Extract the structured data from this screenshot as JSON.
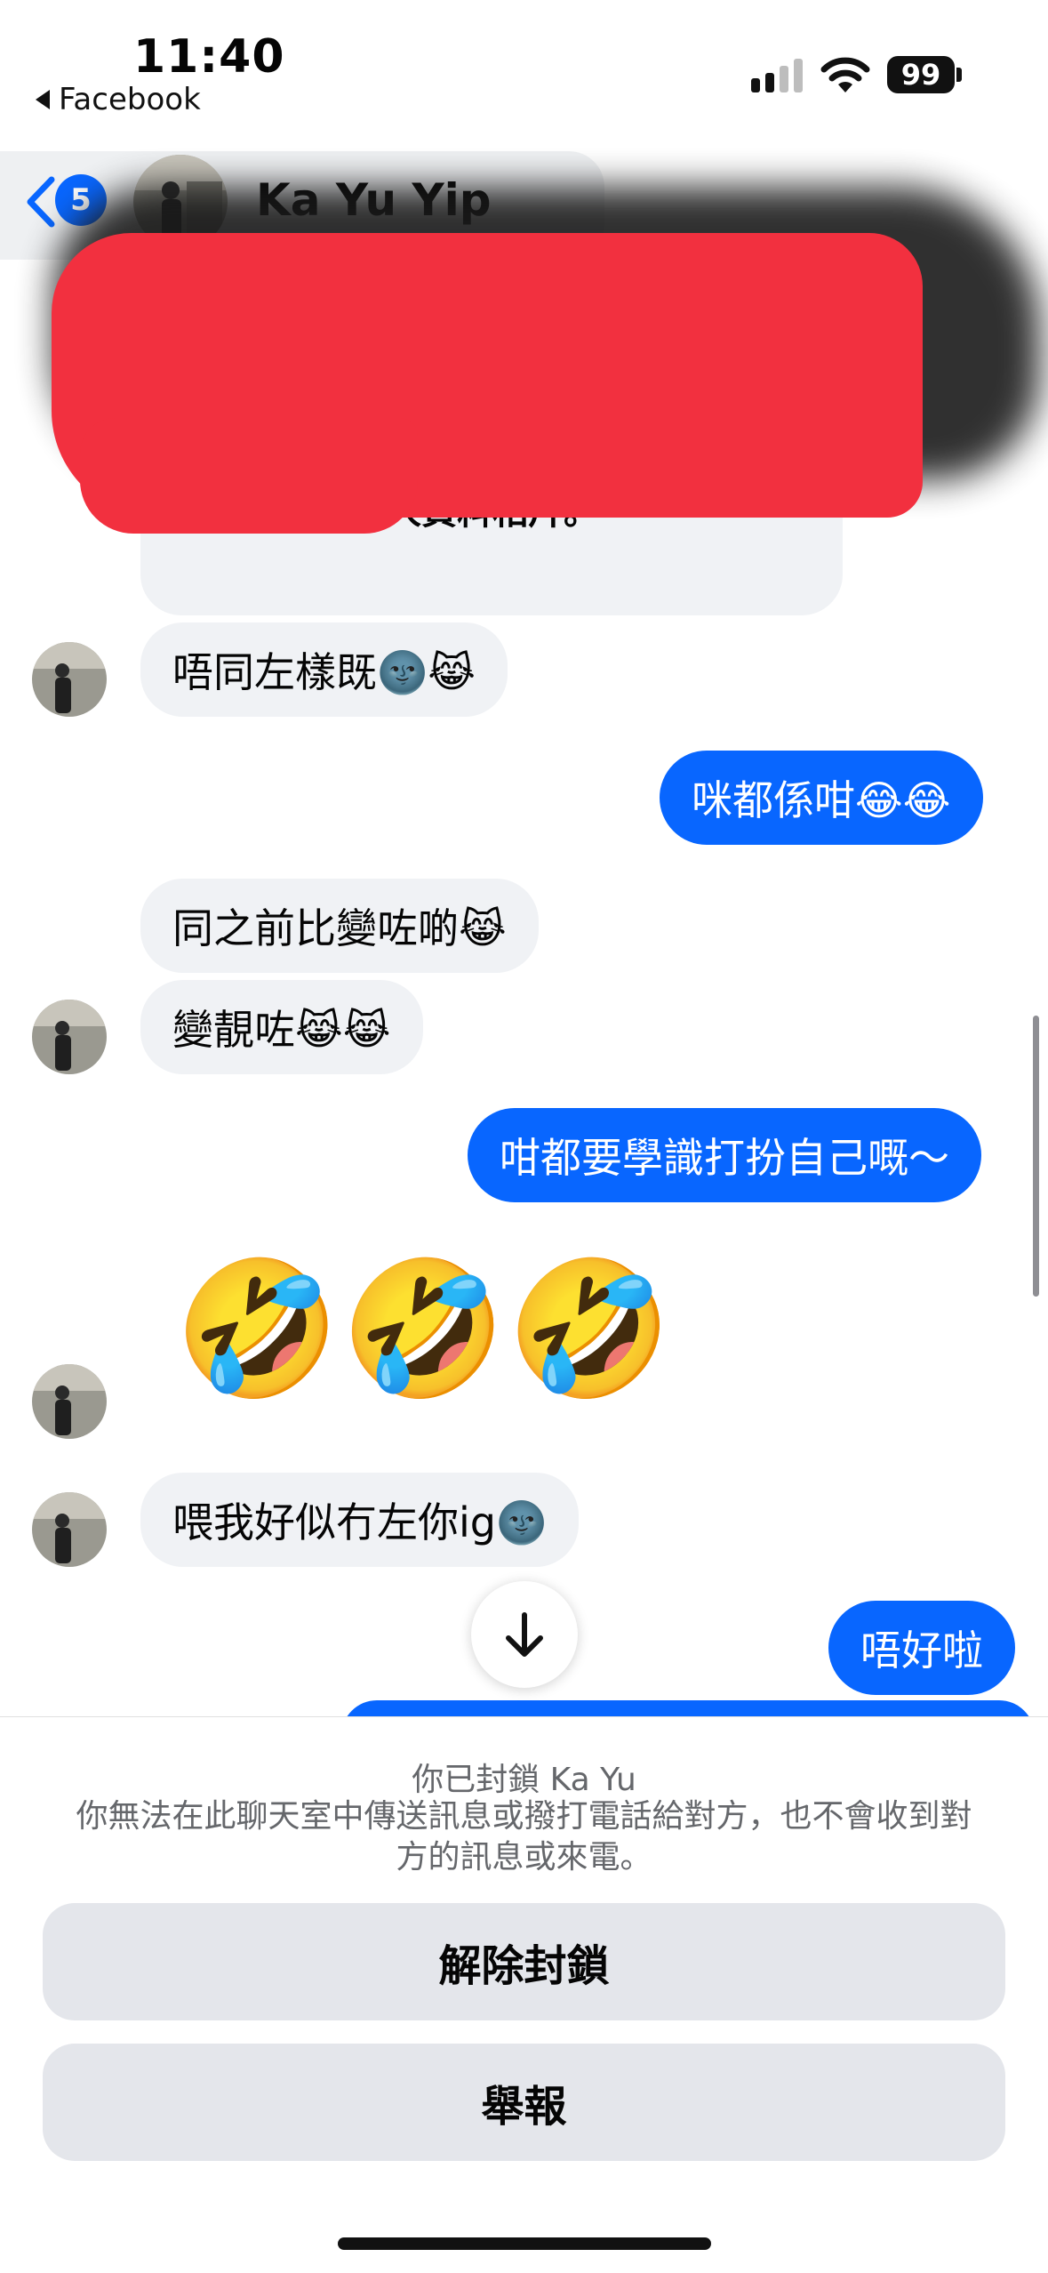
{
  "status_bar": {
    "time": "11:40",
    "back_app_label": "Facebook",
    "battery": "99"
  },
  "header": {
    "unread_count": "5",
    "contact_name": "Ka Yu Yip"
  },
  "conversation": {
    "system_message": "更新了她的個人資料相片。",
    "messages": [
      {
        "side": "in",
        "text": "唔同左樣既🌚😹"
      },
      {
        "side": "out",
        "text": "咪都係咁😂😂"
      },
      {
        "side": "in",
        "text": "同之前比變咗啲😹"
      },
      {
        "side": "in",
        "text": "變靚咗😹😹"
      },
      {
        "side": "out",
        "text": "咁都要學識打扮自己嘅～"
      },
      {
        "side": "in",
        "text": "🤣🤣🤣"
      },
      {
        "side": "in",
        "text": "喂我好似冇左你ig🌚"
      },
      {
        "side": "out",
        "text": "唔好啦"
      }
    ]
  },
  "blocked_sheet": {
    "title": "你已封鎖 Ka Yu",
    "description": "你無法在此聊天室中傳送訊息或撥打電話給對方，也不會收到對方的訊息或來電。",
    "unblock_label": "解除封鎖",
    "report_label": "舉報"
  },
  "colors": {
    "accent": "#0866ff",
    "incoming_bubble": "#f0f2f5",
    "sheet_button": "#e4e6eb"
  }
}
